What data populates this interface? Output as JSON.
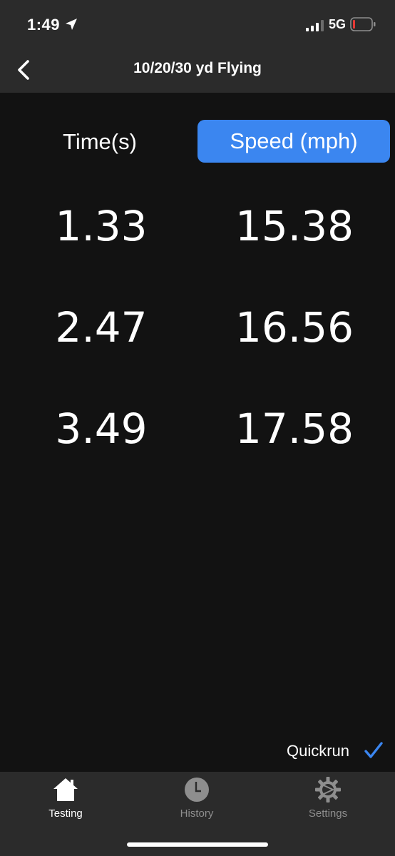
{
  "status_bar": {
    "time": "1:49",
    "network": "5G"
  },
  "nav": {
    "title": "10/20/30 yd Flying"
  },
  "segments": {
    "time_label": "Time(s)",
    "speed_label": "Speed (mph)",
    "selected": "Speed (mph)"
  },
  "rows": [
    {
      "time": "1.33",
      "speed": "15.38"
    },
    {
      "time": "2.47",
      "speed": "16.56"
    },
    {
      "time": "3.49",
      "speed": "17.58"
    }
  ],
  "quickrun": {
    "label": "Quickrun",
    "checked": true
  },
  "tabs": [
    {
      "label": "Testing",
      "icon": "home-icon",
      "active": true
    },
    {
      "label": "History",
      "icon": "clock-icon",
      "active": false
    },
    {
      "label": "Settings",
      "icon": "gear-icon",
      "active": false
    }
  ],
  "colors": {
    "accent": "#3b86f0",
    "background": "#121212",
    "bar": "#2b2b2b",
    "battery_low": "#e53935",
    "inactive_tab": "#8e8e8e"
  }
}
